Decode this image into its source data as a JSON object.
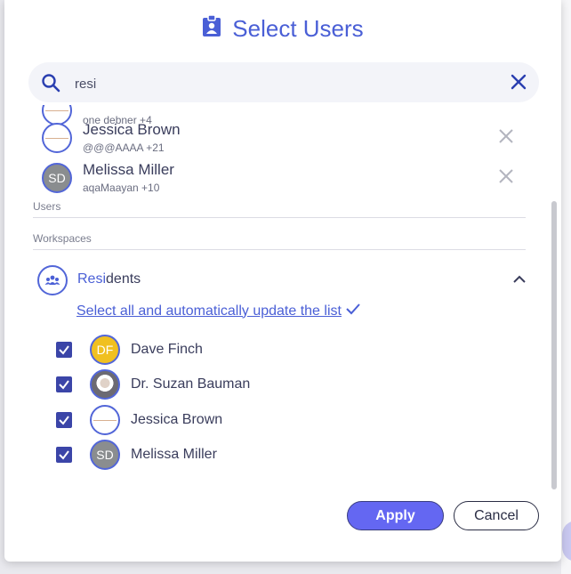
{
  "modal": {
    "title": "Select Users",
    "search": {
      "value": "resi",
      "placeholder": ""
    }
  },
  "selected": {
    "partial_text": "one debner +4",
    "items": [
      {
        "name": "Jessica Brown",
        "sub": "@@@AAAA +21",
        "avatar": ""
      },
      {
        "name": "Melissa Miller",
        "sub": "aqaMaayan +10",
        "avatar": "SD"
      }
    ]
  },
  "sections": {
    "users": "Users",
    "workspaces": "Workspaces"
  },
  "workspace": {
    "name_match": "Resi",
    "name_rest": "dents",
    "select_all": "Select all and automatically update the list",
    "members": [
      {
        "name": "Dave Finch",
        "avatar": "DF",
        "checked": true
      },
      {
        "name": "Dr. Suzan Bauman",
        "avatar": "",
        "checked": true
      },
      {
        "name": "Jessica Brown",
        "avatar": "",
        "checked": true
      },
      {
        "name": "Melissa Miller",
        "avatar": "SD",
        "checked": true
      }
    ]
  },
  "buttons": {
    "apply": "Apply",
    "cancel": "Cancel"
  },
  "colors": {
    "accent": "#4a5fd6",
    "apply_bg": "#6467f2",
    "checkbox": "#3b45a8",
    "avatar_border": "#5266d8"
  },
  "icons": {
    "title": "clipboard-user-icon",
    "search": "search-icon",
    "clear": "close-icon",
    "remove": "close-icon",
    "workspace": "group-icon",
    "collapse": "chevron-up-icon",
    "confirm": "check-icon"
  }
}
